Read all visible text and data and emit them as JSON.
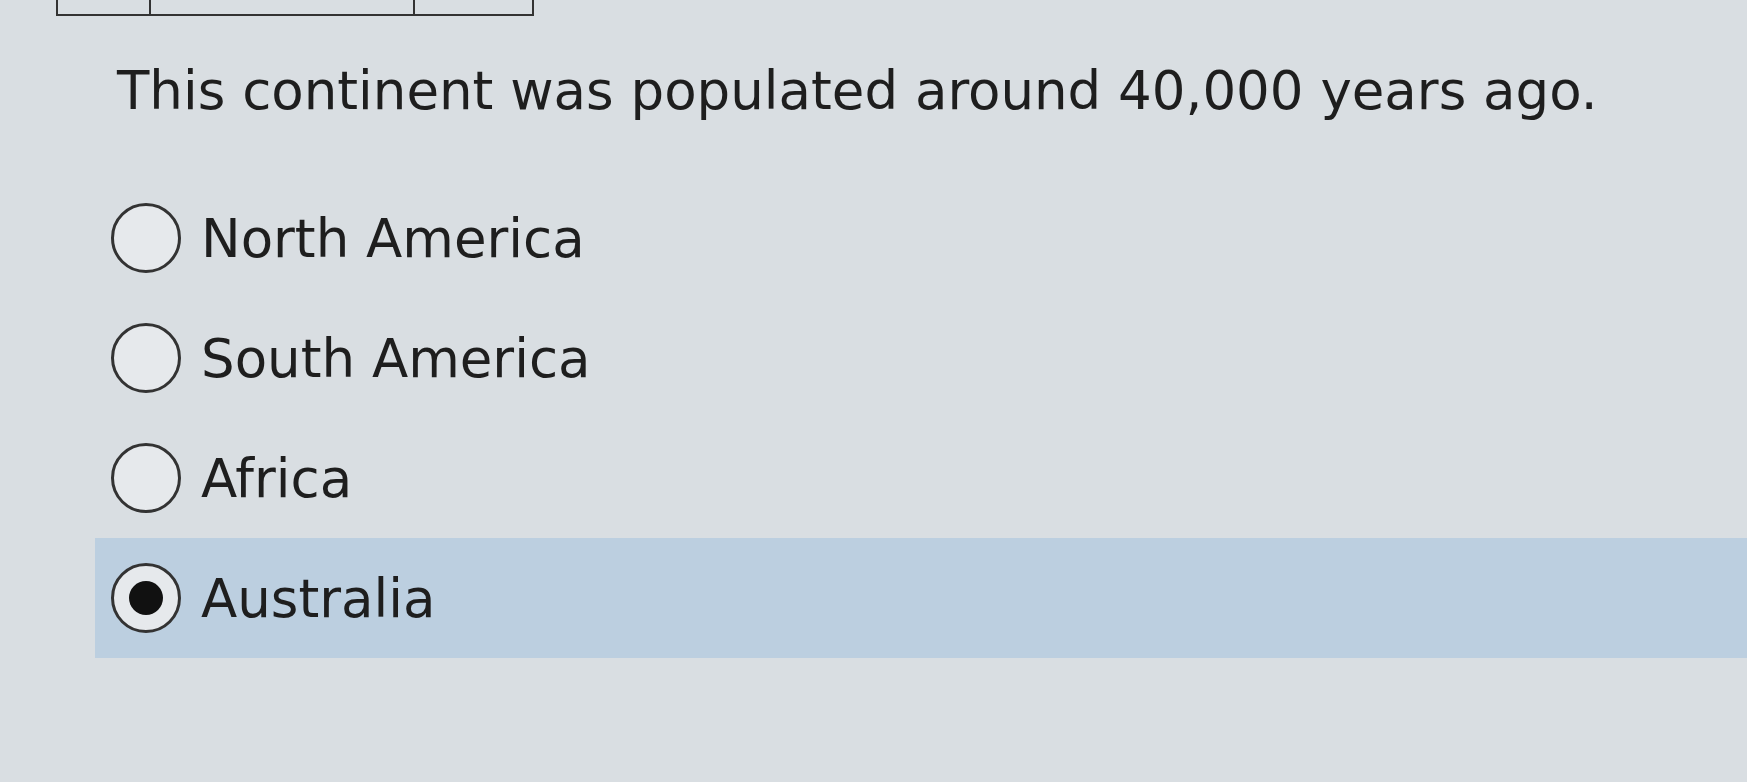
{
  "question": "This continent was populated around 40,000 years ago.",
  "options": [
    {
      "label": "North America",
      "selected": false
    },
    {
      "label": "South America",
      "selected": false
    },
    {
      "label": "Africa",
      "selected": false
    },
    {
      "label": "Australia",
      "selected": true
    }
  ]
}
